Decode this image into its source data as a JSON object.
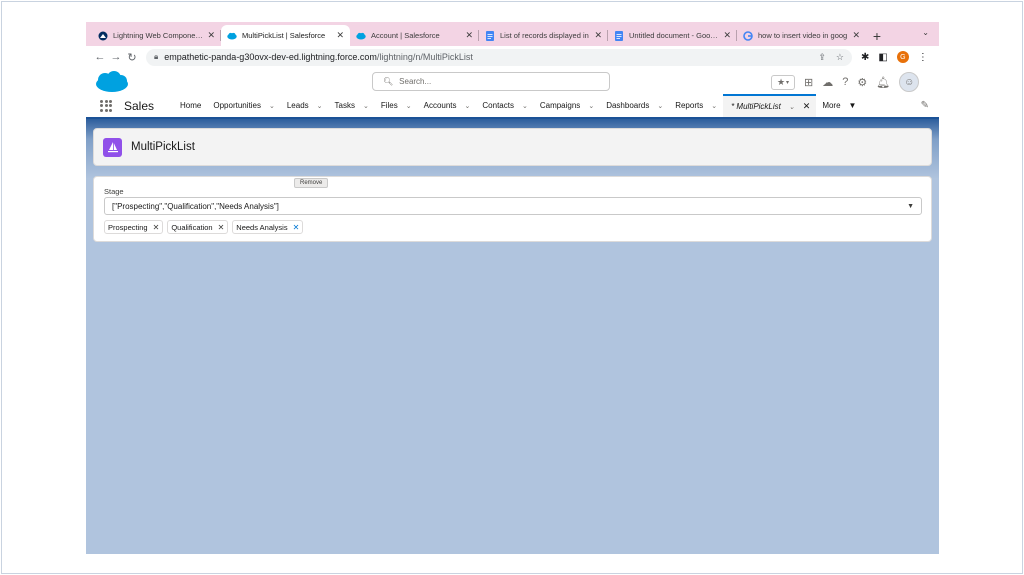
{
  "browser": {
    "tabs": [
      {
        "title": "Lightning Web Components",
        "icon": "trailhead-icon",
        "active": false
      },
      {
        "title": "MultiPickList | Salesforce",
        "icon": "salesforce-cloud-icon",
        "active": true
      },
      {
        "title": "Account | Salesforce",
        "icon": "salesforce-cloud-icon",
        "active": false
      },
      {
        "title": "List of records displayed in",
        "icon": "docs-icon",
        "active": false
      },
      {
        "title": "Untitled document - Google",
        "icon": "docs-icon",
        "active": false
      },
      {
        "title": "how to insert video in goog",
        "icon": "google-icon",
        "active": false
      }
    ],
    "url_domain": "empathetic-panda-g30ovx-dev-ed.lightning.force.com",
    "url_path": "/lightning/n/MultiPickList",
    "profile_initial": "G"
  },
  "salesforce": {
    "search_placeholder": "Search...",
    "app_name": "Sales",
    "nav_items": [
      "Home",
      "Opportunities",
      "Leads",
      "Tasks",
      "Files",
      "Accounts",
      "Contacts",
      "Campaigns",
      "Dashboards",
      "Reports"
    ],
    "active_tab": "* MultiPickList",
    "more_label": "More"
  },
  "page": {
    "title": "MultiPickList",
    "field_label": "Stage",
    "combobox_value": "[\"Prospecting\",\"Qualification\",\"Needs Analysis\"]",
    "pills": [
      "Prospecting",
      "Qualification",
      "Needs Analysis"
    ],
    "tooltip": "Remove"
  },
  "colors": {
    "tabbar": "#f3d4e4",
    "salesforce_blue": "#0176d3",
    "app_icon": "#9050e9",
    "page_background": "#b0c4de"
  }
}
